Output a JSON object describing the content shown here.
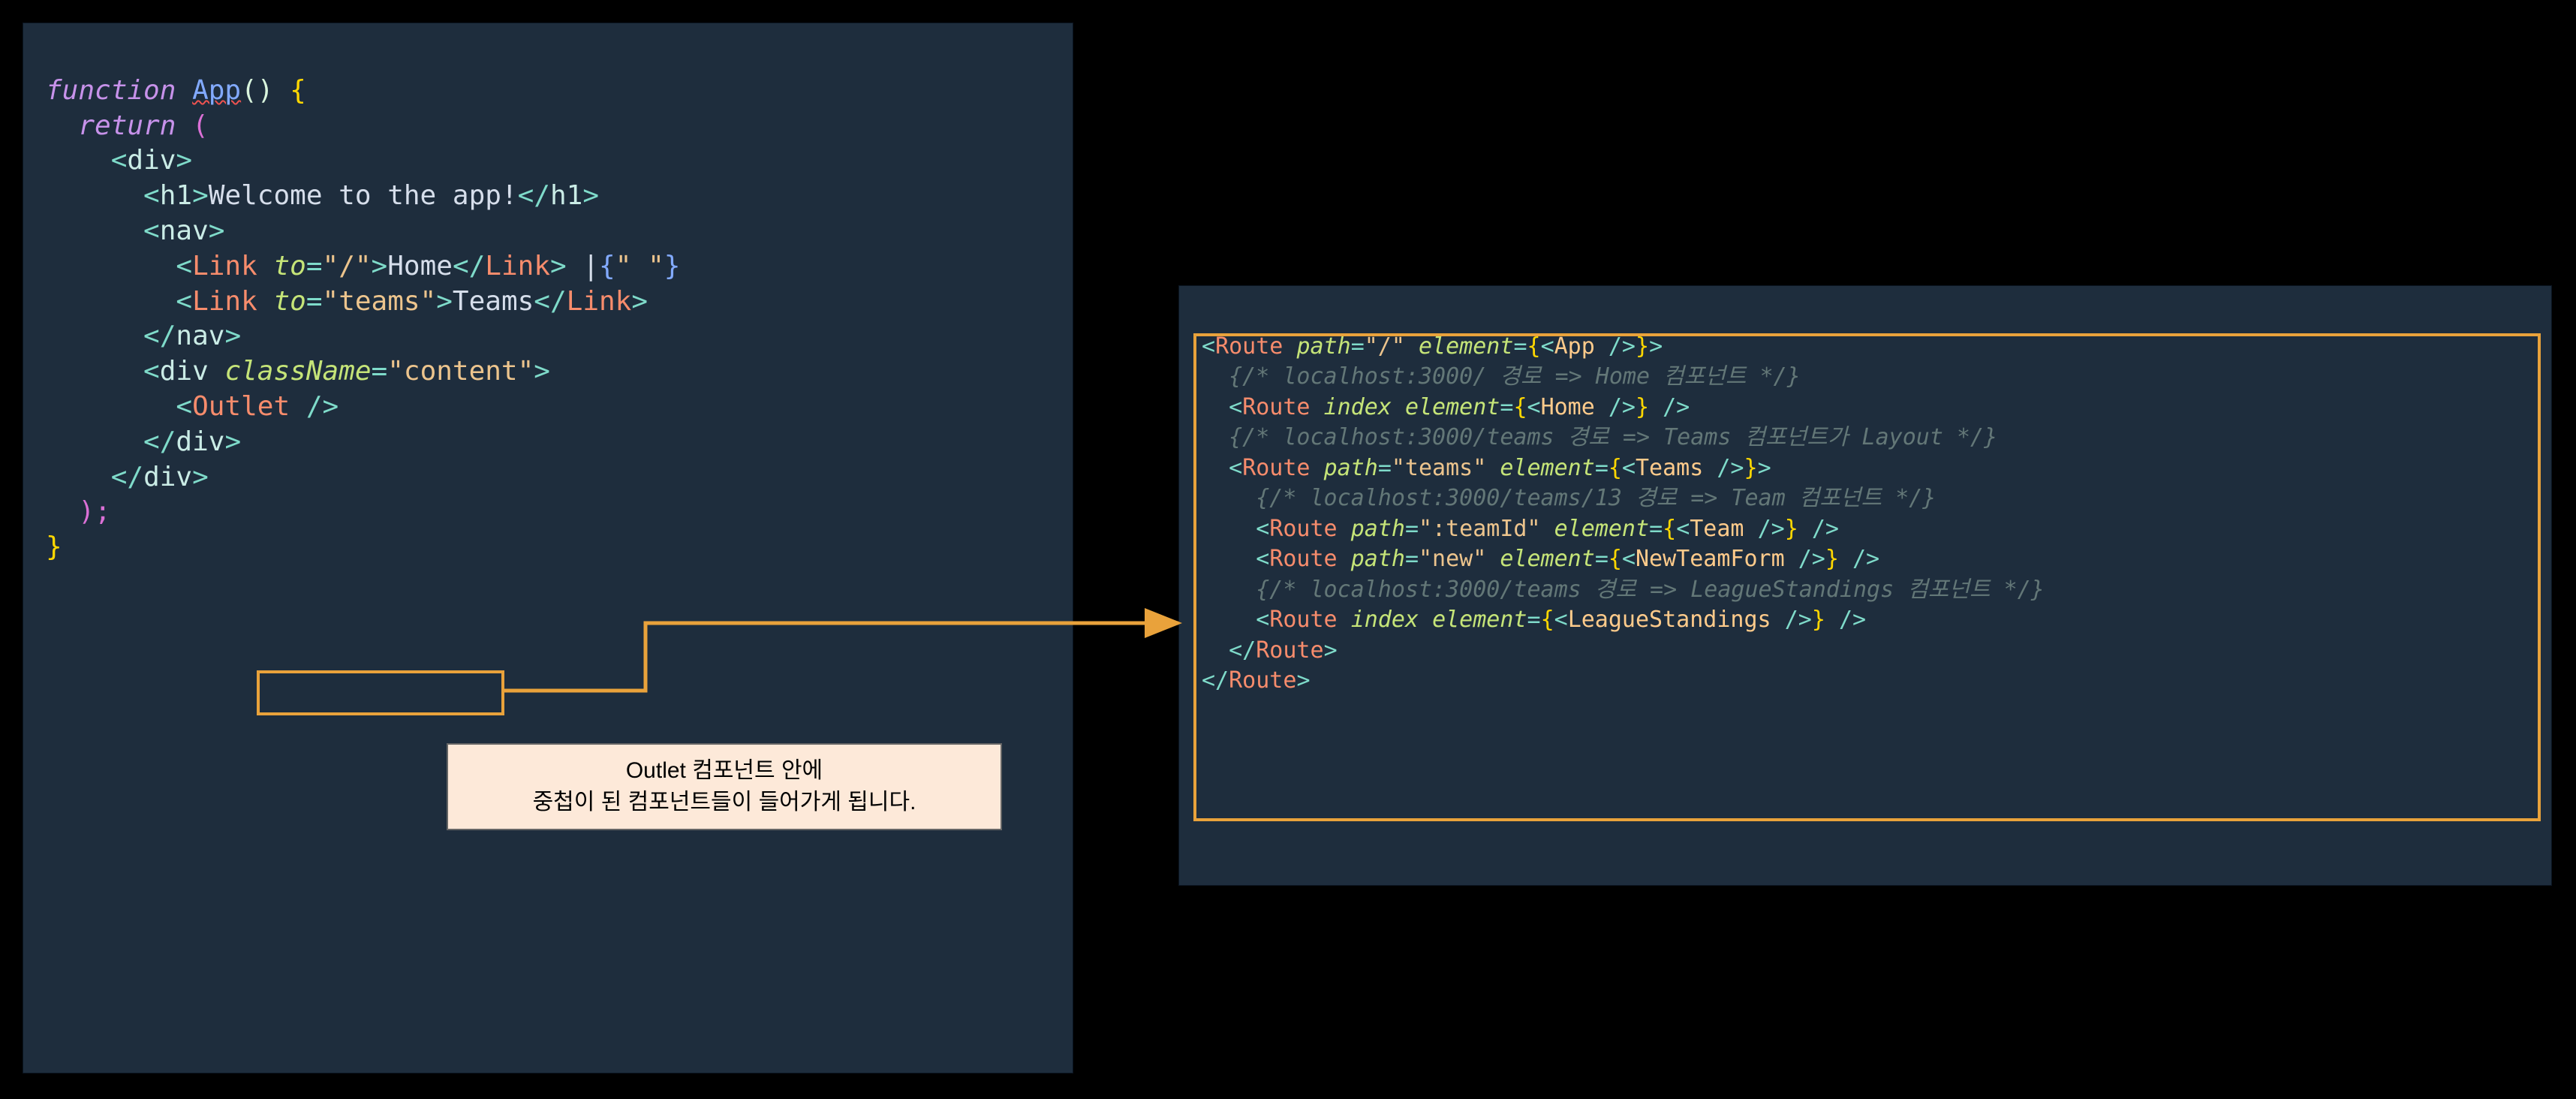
{
  "left": {
    "l1_function": "function",
    "l1_app": "App",
    "l1_parens": "()",
    "l1_brace": " {",
    "l2_return": "return",
    "l2_paren": " (",
    "l3_div_open": "div",
    "l4_h1_open": "h1",
    "l4_text": "Welcome to the app!",
    "l4_h1_close": "h1",
    "l5_nav_open": "nav",
    "l6_link": "Link",
    "l6_to": "to",
    "l6_val1": "\"/\"",
    "l6_text": "Home",
    "l6_pipe": " |",
    "l6_expr": "\" \"",
    "l7_link": "Link",
    "l7_to": "to",
    "l7_val2": "\"teams\"",
    "l7_text": "Teams",
    "l8_nav_close": "nav",
    "l9_div": "div",
    "l9_cn": "className",
    "l9_val": "\"content\"",
    "l10_outlet": "Outlet",
    "l11_div_close": "div",
    "l12_div_close": "div",
    "l13_paren": ");",
    "l14_brace": "}"
  },
  "right": {
    "l1_route": "Route",
    "l1_path": "path",
    "l1_pathv": "\"/\"",
    "l1_element": "element",
    "l1_app": "App",
    "c1": "{/* localhost:3000/ 경로 => Home 컴포넌트 */}",
    "l2_route": "Route",
    "l2_index": "index",
    "l2_element": "element",
    "l2_home": "Home",
    "c2": "{/* localhost:3000/teams 경로 => Teams 컴포넌트가 Layout */}",
    "l3_route": "Route",
    "l3_path": "path",
    "l3_pathv": "\"teams\"",
    "l3_element": "element",
    "l3_teams": "Teams",
    "c3": "{/* localhost:3000/teams/13 경로 => Team 컴포넌트 */}",
    "l4_route": "Route",
    "l4_path": "path",
    "l4_pathv": "\":teamId\"",
    "l4_element": "element",
    "l4_team": "Team",
    "l5_route": "Route",
    "l5_path": "path",
    "l5_pathv": "\"new\"",
    "l5_element": "element",
    "l5_new": "NewTeamForm",
    "c4": "{/* localhost:3000/teams 경로 => LeagueStandings 컴포넌트 */}",
    "l6_route": "Route",
    "l6_index": "index",
    "l6_element": "element",
    "l6_ls": "LeagueStandings",
    "l7_close": "Route",
    "l8_close": "Route"
  },
  "callout": {
    "line1": "Outlet 컴포넌트 안에",
    "line2": "중첩이 된 컴포넌트들이 들어가게 됩니다."
  }
}
